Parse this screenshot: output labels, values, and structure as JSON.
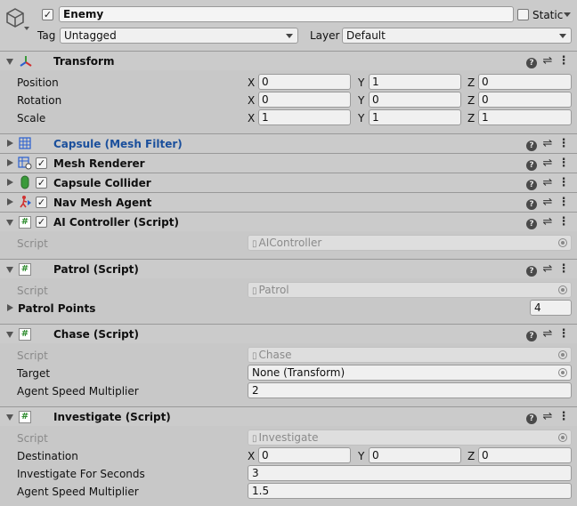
{
  "header": {
    "name": "Enemy",
    "active_checked": true,
    "static_label": "Static",
    "tag_label": "Tag",
    "tag_value": "Untagged",
    "layer_label": "Layer",
    "layer_value": "Default"
  },
  "transform": {
    "title": "Transform",
    "position_label": "Position",
    "rotation_label": "Rotation",
    "scale_label": "Scale",
    "x": "X",
    "y": "Y",
    "z": "Z",
    "position": [
      "0",
      "1",
      "0"
    ],
    "rotation": [
      "0",
      "0",
      "0"
    ],
    "scale": [
      "1",
      "1",
      "1"
    ]
  },
  "components": {
    "mesh_filter": "Capsule (Mesh Filter)",
    "mesh_renderer": "Mesh Renderer",
    "capsule_collider": "Capsule Collider",
    "nav_mesh_agent": "Nav Mesh Agent",
    "ai_controller": "AI Controller (Script)",
    "patrol": "Patrol (Script)",
    "chase": "Chase (Script)",
    "investigate": "Investigate (Script)"
  },
  "ai_controller": {
    "script_label": "Script",
    "script_value": "AIController"
  },
  "patrol": {
    "script_label": "Script",
    "script_value": "Patrol",
    "points_label": "Patrol Points",
    "points_count": "4"
  },
  "chase": {
    "script_label": "Script",
    "script_value": "Chase",
    "target_label": "Target",
    "target_value": "None (Transform)",
    "speed_label": "Agent Speed Multiplier",
    "speed_value": "2"
  },
  "investigate": {
    "script_label": "Script",
    "script_value": "Investigate",
    "destination_label": "Destination",
    "destination": [
      "0",
      "0",
      "0"
    ],
    "seconds_label": "Investigate For Seconds",
    "seconds_value": "3",
    "speed_label": "Agent Speed Multiplier",
    "speed_value": "1.5"
  },
  "colors": {
    "accent_link": "#1a4f9c",
    "background": "#c8c8c8"
  }
}
